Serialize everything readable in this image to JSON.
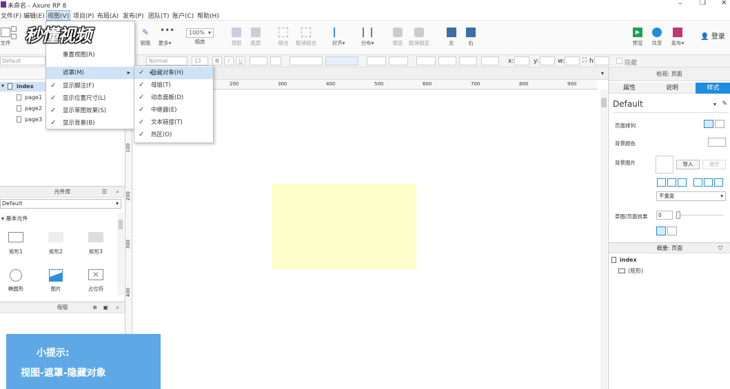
{
  "window": {
    "title": "未命名 - Axure RP 8"
  },
  "menu": [
    "文件(F)",
    "编辑(E)",
    "视图(V)",
    "项目(P)",
    "布局(A)",
    "发布(P)",
    "团队(T)",
    "账户(C)",
    "帮助(H)"
  ],
  "watermark": "秒懂视频",
  "toolbar": {
    "file": "文件",
    "pen": "钢笔",
    "more": "更多▾",
    "zoom": "100%",
    "zoom_label": "缩放",
    "top": "顶层",
    "bottom": "底层",
    "group": "组合",
    "ungroup": "取消组合",
    "align": "对齐▾",
    "distribute": "分布▾",
    "lock": "锁定",
    "unlock": "取消锁定",
    "left": "左",
    "right": "右",
    "preview": "预览",
    "share": "共享",
    "publish": "发布▾",
    "login": "登录"
  },
  "stylebar": {
    "style": "Default",
    "font": "Normal",
    "size": "13",
    "x": "x:",
    "y": "y:",
    "w": "w:",
    "h": "h:",
    "hide": "隐藏"
  },
  "pages": {
    "root": "index",
    "items": [
      "page1",
      "page2",
      "page3"
    ]
  },
  "library": {
    "title": "元件库",
    "select": "Default",
    "section": "基本元件",
    "items": [
      "矩形1",
      "矩形2",
      "矩形3",
      "椭圆形",
      "图片",
      "占位符"
    ]
  },
  "masters": {
    "title": "母版"
  },
  "view_menu": {
    "reset": "重置视图(R)",
    "mask": "遮罩(M)",
    "footnotes": "显示脚注(F)",
    "size": "显示位置尺寸(L)",
    "sketch": "显示草图效果(S)",
    "bg": "显示背景(B)"
  },
  "mask_menu": [
    "隐藏对象(H)",
    "母版(T)",
    "动态面板(D)",
    "中继器(E)",
    "文本链接(T)",
    "热区(O)"
  ],
  "ruler": {
    "h": [
      "200",
      "300",
      "400",
      "500",
      "600",
      "700",
      "800",
      "900"
    ],
    "v": [
      "100",
      "200",
      "300",
      "400"
    ]
  },
  "inspector": {
    "title": "检视: 页面",
    "tabs": [
      "属性",
      "说明",
      "样式"
    ],
    "style": "Default",
    "align_label": "页面排列",
    "bgcolor": "背景颜色",
    "bgimage": "背景图片",
    "import": "导入",
    "clear": "清空",
    "repeat": "不重复",
    "sketch_label": "草图/页面效果",
    "sketch_value": "0"
  },
  "outline": {
    "title": "概要: 页面",
    "root": "index",
    "item": "(矩形)"
  },
  "hint": {
    "line1": "小提示:",
    "line2": "视图-遮罩-隐藏对象"
  },
  "colors": {
    "accent": "#1e8ddf",
    "rect": "#ffffcc"
  }
}
